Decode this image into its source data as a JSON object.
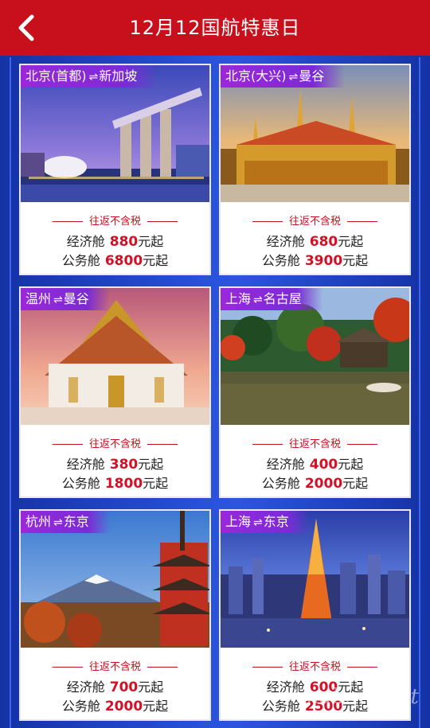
{
  "header": {
    "title": "12月12国航特惠日"
  },
  "arrow": "⇌",
  "tax_label": "往返不含税",
  "economy_label": "经济舱",
  "business_label": "公务舱",
  "price_suffix": "元起",
  "cards": [
    {
      "from": "北京(首都)",
      "to": "新加坡",
      "economy_price": "880",
      "business_price": "6800"
    },
    {
      "from": "北京(大兴)",
      "to": "曼谷",
      "economy_price": "680",
      "business_price": "3900"
    },
    {
      "from": "温州",
      "to": "曼谷",
      "economy_price": "380",
      "business_price": "1800"
    },
    {
      "from": "上海",
      "to": "名古屋",
      "economy_price": "400",
      "business_price": "2000"
    },
    {
      "from": "杭州",
      "to": "东京",
      "economy_price": "700",
      "business_price": "2000"
    },
    {
      "from": "上海",
      "to": "东京",
      "economy_price": "600",
      "business_price": "2500"
    }
  ],
  "watermark": "ctmabing.net",
  "colors": {
    "header": "#c8101d",
    "background": "#1d3fb8",
    "price": "#d51025",
    "route_tag": "#8a2ad8"
  },
  "icons": {
    "back": "chevron-left-icon"
  }
}
